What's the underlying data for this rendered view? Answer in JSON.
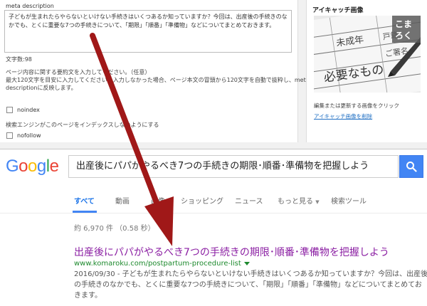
{
  "wp": {
    "meta_label": "meta description",
    "meta_text": "子どもが生まれたらやらないといけない手続きはいくつあるか知っていますか？今回は、出産後の手続きのなかでも、とくに重要な7つの手続きについて、「期限」「順番」「準備物」などについてまとめておきます。",
    "char_count": "文字数:98",
    "help_lines": [
      "ページ内容に関する要約文を入力してください。（任意）",
      "最大120文字を目安に入力してください。入力しなかった場合、ページ本文の冒頭から120文字を自動で抜粋し、meta",
      "descriptionに反映します。"
    ],
    "noindex_label": "noindex",
    "noindex_desc": "検索エンジンがこのページをインデックスしないようにする",
    "nofollow_label": "nofollow",
    "side_title": "アイキャッチ画像",
    "thumb_caption": "編集または更新する画像をクリック",
    "thumb_remove": "アイキャッチ画像を削除",
    "thumb_form_lines": [
      "未成年",
      "必要なもの",
      "ご署名",
      "戸籍"
    ],
    "thumb_logo": [
      "こま",
      "ろく"
    ]
  },
  "google": {
    "logo_letters": [
      "G",
      "o",
      "o",
      "g",
      "l",
      "e"
    ],
    "logo_colors": [
      "#4285f4",
      "#ea4335",
      "#fbbc05",
      "#4285f4",
      "#34a853",
      "#ea4335"
    ],
    "query": "出産後にパパがやるべき7つの手続きの期限･順番･準備物を把握しよう",
    "search_icon": "search-icon",
    "tabs": [
      "すべて",
      "動画",
      "画像",
      "ショッピング",
      "ニュース",
      "もっと見る",
      "検索ツール"
    ],
    "stats": "約 6,970 件 （0.58 秒）",
    "result_title": "出産後にパパがやるべき7つの手続きの期限･順番･準備物を把握しよう",
    "result_url": "www.komaroku.com/postpartum-procedure-list",
    "snippet_lines": [
      "2016/09/30 - 子どもが生まれたらやらないといけない手続きはいくつあるか知っていますか？今回は、出産後",
      "の手続きのなかでも、とくに重要な7つの手続きについて、「期限」「順番」「準備物」などについてまとめてお",
      "きます。"
    ]
  },
  "colors": {
    "arrow": "#a01818",
    "visited_link": "#8b1fa3",
    "url_green": "#1e8a2e",
    "google_blue": "#4285f4"
  }
}
